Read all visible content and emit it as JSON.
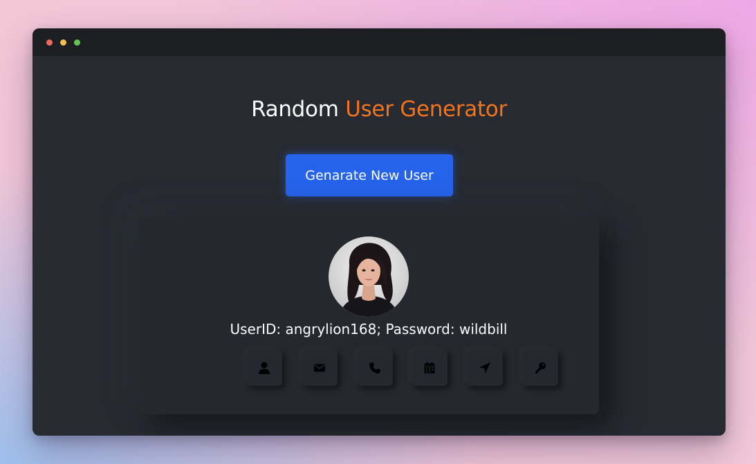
{
  "page": {
    "background_colors": [
      "#f3c7d6",
      "#eea8e6",
      "#9ec0ec"
    ]
  },
  "window": {
    "titlebar_color": "#1d1e21",
    "content_color": "#272a31",
    "controls": [
      {
        "name": "close",
        "color": "#ec6a5e"
      },
      {
        "name": "minimize",
        "color": "#f4bf4f"
      },
      {
        "name": "maximize",
        "color": "#61c554"
      }
    ]
  },
  "header": {
    "title_part1": "Random ",
    "title_part2": "User Generator",
    "accent_color": "#f1751f"
  },
  "generate_button": {
    "label": "Genarate New User",
    "color": "#2563eb"
  },
  "user_card": {
    "avatar_icon": "user-photo",
    "info_text": "UserID: angrylion168; Password: wildbill",
    "icons": [
      {
        "name": "user-icon"
      },
      {
        "name": "envelope-icon"
      },
      {
        "name": "phone-icon"
      },
      {
        "name": "calendar-icon"
      },
      {
        "name": "location-arrow-icon"
      },
      {
        "name": "key-icon"
      }
    ]
  }
}
